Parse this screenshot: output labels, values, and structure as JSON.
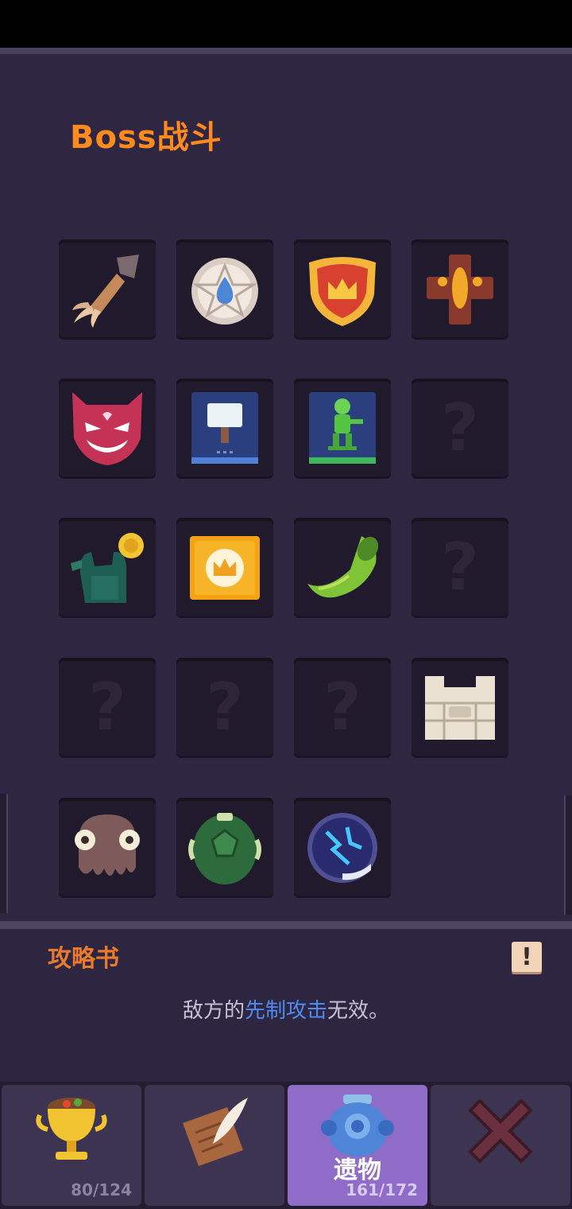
{
  "header": {
    "title": "Boss战斗"
  },
  "relics": [
    {
      "icon": "wooden-arrow-icon"
    },
    {
      "icon": "water-drop-seal-icon"
    },
    {
      "icon": "crown-shield-icon"
    },
    {
      "icon": "golden-cross-icon"
    },
    {
      "icon": "devil-mask-icon"
    },
    {
      "icon": "hammer-book-icon"
    },
    {
      "icon": "soldier-book-icon"
    },
    {
      "icon": "locked-relic-icon",
      "label": "?"
    },
    {
      "icon": "green-glove-coin-icon"
    },
    {
      "icon": "golden-crown-box-icon"
    },
    {
      "icon": "green-horn-icon"
    },
    {
      "icon": "locked-relic-icon",
      "label": "?"
    },
    {
      "icon": "locked-relic-icon",
      "label": "?"
    },
    {
      "icon": "locked-relic-icon",
      "label": "?"
    },
    {
      "icon": "locked-relic-icon",
      "label": "?"
    },
    {
      "icon": "stone-castle-icon"
    },
    {
      "icon": "octopus-icon"
    },
    {
      "icon": "turtle-shell-icon"
    },
    {
      "icon": "lightning-orb-icon"
    }
  ],
  "guide": {
    "title": "攻略书",
    "info_label": "!",
    "desc_before": "敌方的",
    "desc_highlight": "先制攻击",
    "desc_after": "无效。"
  },
  "tabs": [
    {
      "icon": "golden-trophy-icon",
      "count": "80/124"
    },
    {
      "icon": "scroll-quill-icon",
      "count": ""
    },
    {
      "icon": "blue-vase-icon",
      "label": "遗物",
      "count": "161/172",
      "active": true
    },
    {
      "icon": "close-x-icon",
      "count": ""
    }
  ],
  "colors": {
    "accent_orange": "#ff8a1e",
    "highlight_blue": "#4f8bf0",
    "active_tab": "#8f6cc8"
  }
}
